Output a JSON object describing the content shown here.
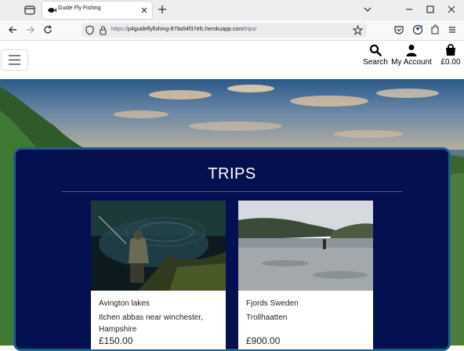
{
  "browser": {
    "tab_title": "Guide Fly Fishing",
    "url_prefix": "https://",
    "url_host": "p4guideflyfishing-879a54f37efc.herokuapp.com",
    "url_path": "/trips/"
  },
  "header": {
    "search_label": "Search",
    "account_label": "My Account",
    "cart_total": "£0.00"
  },
  "page": {
    "title": "TRIPS"
  },
  "trips": [
    {
      "name": "Avington lakes",
      "location": "Itchen abbas near winchester, Hampshire",
      "price": "£150.00"
    },
    {
      "name": "Fjords Sweden",
      "location": "Trollhaatten",
      "price": "£900.00"
    }
  ],
  "colors": {
    "panel": "#04104f",
    "panel_border": "#1f5f86"
  }
}
